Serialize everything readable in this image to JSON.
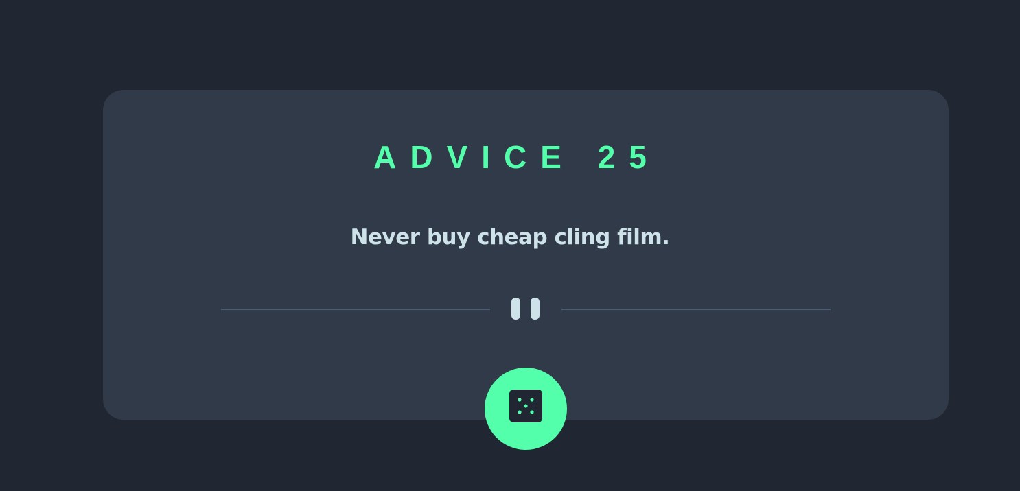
{
  "advice": {
    "id_label": "ADVICE 25",
    "text": "Never buy cheap cling film."
  },
  "icons": {
    "divider": "pause-icon",
    "button": "dice-icon"
  },
  "colors": {
    "background": "#202632",
    "card": "#313A48",
    "accent": "#53FFAA",
    "text": "#CEE3E9",
    "divider": "#4F5D74"
  }
}
